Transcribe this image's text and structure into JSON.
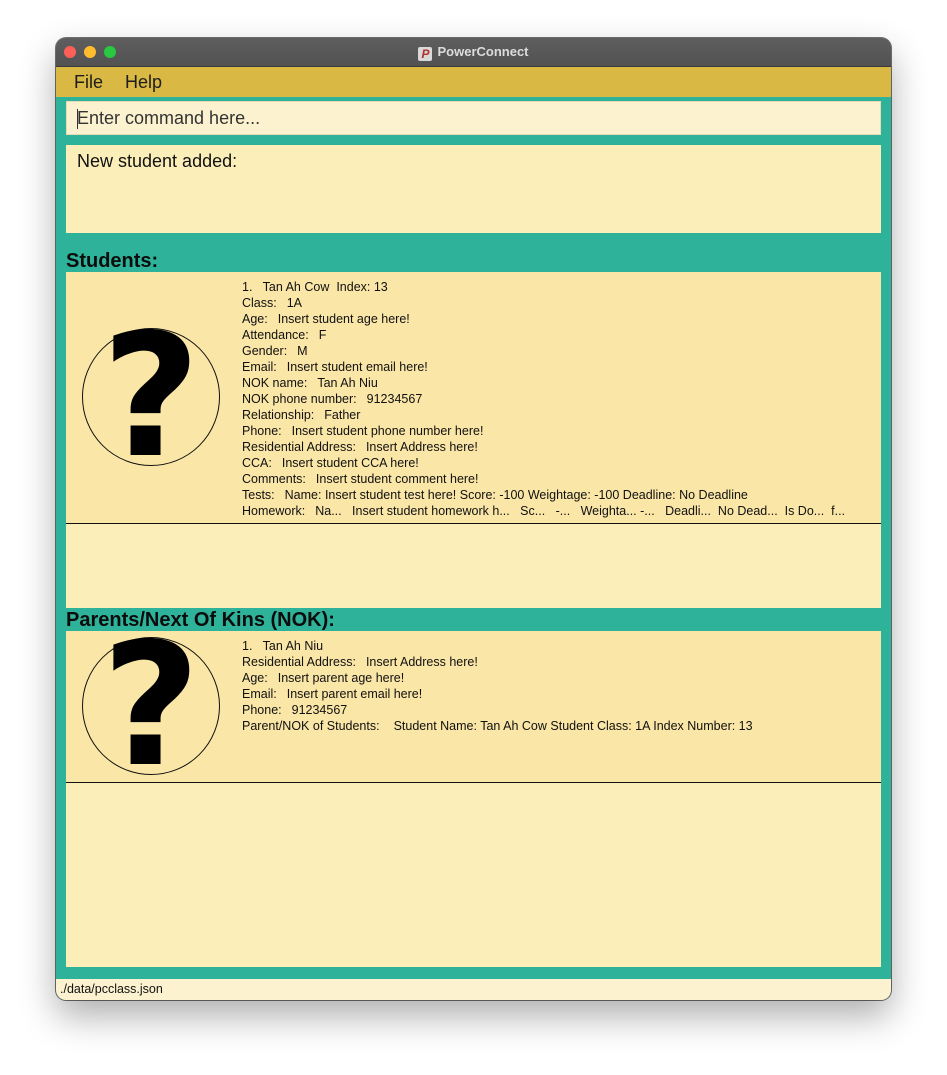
{
  "window": {
    "title": "PowerConnect"
  },
  "menu": {
    "file": "File",
    "help": "Help"
  },
  "command": {
    "placeholder": "Enter command here...",
    "value": ""
  },
  "result": {
    "text": "New student added:"
  },
  "students": {
    "heading": "Students:",
    "items": [
      {
        "number": "1.",
        "name": "Tan Ah Cow",
        "index_label": "Index:",
        "index_value": "13",
        "fields": [
          {
            "label": "Class:",
            "value": "1A"
          },
          {
            "label": "Age:",
            "value": "Insert student age here!"
          },
          {
            "label": "Attendance:",
            "value": "F"
          },
          {
            "label": "Gender:",
            "value": "M"
          },
          {
            "label": "Email:",
            "value": "Insert student email here!"
          },
          {
            "label": "NOK name:",
            "value": "Tan Ah Niu"
          },
          {
            "label": "NOK phone number:",
            "value": "91234567"
          },
          {
            "label": "Relationship:",
            "value": "Father"
          },
          {
            "label": "Phone:",
            "value": "Insert student phone number here!"
          },
          {
            "label": "Residential Address:",
            "value": "Insert Address here!"
          },
          {
            "label": "CCA:",
            "value": "Insert student CCA here!"
          },
          {
            "label": "Comments:",
            "value": "Insert student comment here!"
          },
          {
            "label": "Tests:",
            "value": "Name: Insert student test here! Score: -100 Weightage: -100 Deadline: No Deadline"
          },
          {
            "label": "Homework:",
            "value": "Na...   Insert student homework h...   Sc...   -...   Weighta... -...   Deadli...  No Dead...  Is Do...  f..."
          }
        ]
      }
    ]
  },
  "parents": {
    "heading": "Parents/Next Of Kins (NOK):",
    "items": [
      {
        "number": "1.",
        "name": "Tan Ah Niu",
        "fields": [
          {
            "label": "Residential Address:",
            "value": "Insert Address here!"
          },
          {
            "label": "Age:",
            "value": "Insert parent age here!"
          },
          {
            "label": "Email:",
            "value": "Insert parent email here!"
          },
          {
            "label": "Phone:",
            "value": "91234567"
          },
          {
            "label": "Parent/NOK of Students:",
            "value": "Student Name: Tan Ah Cow Student Class: 1A Index Number: 13"
          }
        ]
      }
    ]
  },
  "avatar_glyph": "?",
  "status": {
    "file_path": "./data/pcclass.json"
  },
  "colors": {
    "background": "#2eb39a",
    "menubar": "#d9b843",
    "card": "#fae6a6",
    "panel": "#fbeeb9",
    "command": "#fcf2d0"
  }
}
